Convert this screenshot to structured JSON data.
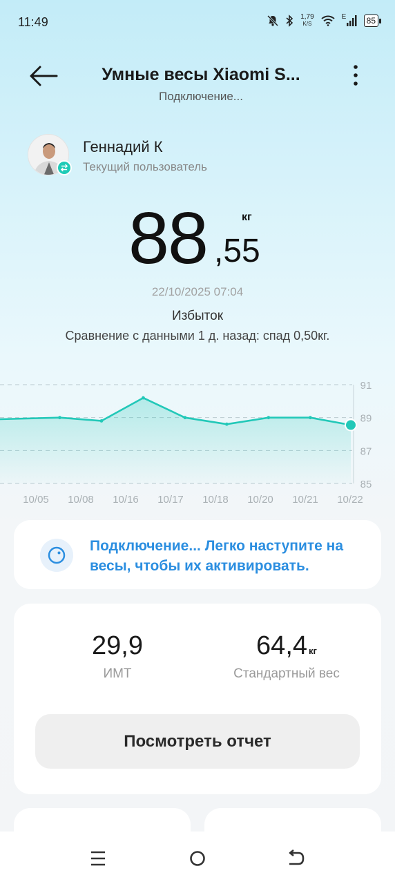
{
  "status_bar": {
    "time": "11:49",
    "speed_value": "1,79",
    "speed_unit": "K/S",
    "network": "E",
    "battery": "85",
    "icons": [
      "bell-muted-icon",
      "bluetooth-icon",
      "wifi-icon",
      "signal-icon",
      "battery-icon"
    ]
  },
  "header": {
    "title": "Умные весы Xiaomi S...",
    "subtitle": "Подключение...",
    "back_icon": "arrow-left-icon",
    "menu_icon": "more-vertical-icon"
  },
  "user": {
    "name": "Геннадий К",
    "role": "Текущий пользователь",
    "badge_icon": "swap-icon"
  },
  "measurement": {
    "weight_int": "88",
    "weight_dec": ",55",
    "unit": "кг",
    "datetime": "22/10/2025 07:04",
    "status": "Избыток",
    "comparison": "Сравнение с данными 1 д. назад: спад 0,50кг."
  },
  "chart_data": {
    "type": "area",
    "categories": [
      "10/05",
      "10/08",
      "10/16",
      "10/17",
      "10/18",
      "10/20",
      "10/21",
      "10/22"
    ],
    "values": [
      88.9,
      89.0,
      88.8,
      90.2,
      89.0,
      88.6,
      89.0,
      89.0,
      88.55
    ],
    "x_positions_days": [
      0,
      1,
      2,
      3,
      4,
      5,
      6,
      7,
      7.97
    ],
    "ylim": [
      85,
      91
    ],
    "yticks": [
      "91",
      "89",
      "87",
      "85"
    ],
    "grid": true,
    "line_color": "#22c8b8",
    "highlight_last": true
  },
  "connect_card": {
    "icon": "scale-icon",
    "text": "Подключение... Легко наступите на весы, чтобы их активировать."
  },
  "stats": {
    "bmi_value": "29,9",
    "bmi_label": "ИМТ",
    "std_weight_value": "64,4",
    "std_weight_unit": "кг",
    "std_weight_label": "Стандартный вес",
    "report_button": "Посмотреть отчет"
  },
  "nav_bar": {
    "icons": [
      "menu-icon",
      "home-circle-icon",
      "back-icon"
    ]
  },
  "colors": {
    "accent": "#22c8b8",
    "link": "#2b8ee0"
  }
}
